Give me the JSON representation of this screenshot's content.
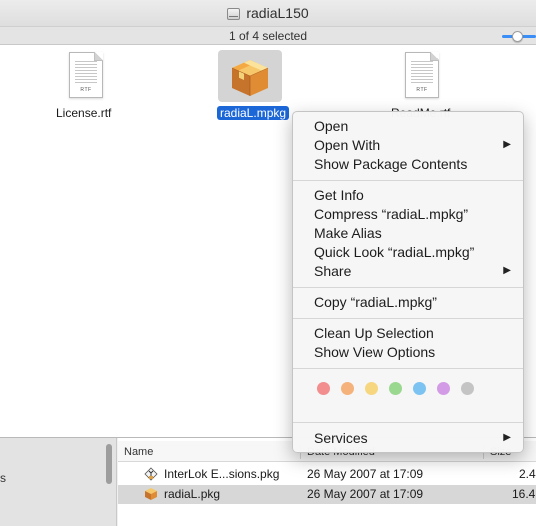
{
  "window": {
    "title": "radiaL150",
    "status": "1 of 4 selected"
  },
  "files": [
    {
      "name": "License.rtf",
      "icon": "rtf-doc-icon",
      "badge": "RTF"
    },
    {
      "name": "radiaL.mpkg",
      "icon": "package-icon",
      "selected": true
    },
    {
      "name": "ReadMe.rtf",
      "icon": "rtf-doc-icon",
      "badge": "RTF"
    }
  ],
  "context_menu": {
    "open": "Open",
    "open_with": "Open With",
    "show_package_contents": "Show Package Contents",
    "get_info": "Get Info",
    "compress": "Compress “radiaL.mpkg”",
    "make_alias": "Make Alias",
    "quick_look": "Quick Look “radiaL.mpkg”",
    "share": "Share",
    "copy": "Copy “radiaL.mpkg”",
    "clean_up": "Clean Up Selection",
    "view_options": "Show View Options",
    "services": "Services",
    "submenu_arrow": "▶",
    "tag_colors": [
      "#f28e8e",
      "#f5b27a",
      "#f6d67f",
      "#9bd88f",
      "#7cc3f2",
      "#d39be6",
      "#c4c4c4"
    ]
  },
  "bottom_window": {
    "sidebar_text": "s",
    "columns": {
      "name": "Name",
      "date": "Date Modified",
      "size": "Size"
    },
    "rows": [
      {
        "name": "InterLok E...sions.pkg",
        "date": "26 May 2007 at 17:09",
        "size": "2.4",
        "icon": "installer-package-icon"
      },
      {
        "name": "radiaL.pkg",
        "date": "26 May 2007 at 17:09",
        "size": "16.4",
        "icon": "package-icon"
      }
    ]
  },
  "colors": {
    "selection": "#1b67d8",
    "slider_accent": "#3a8ef5"
  }
}
